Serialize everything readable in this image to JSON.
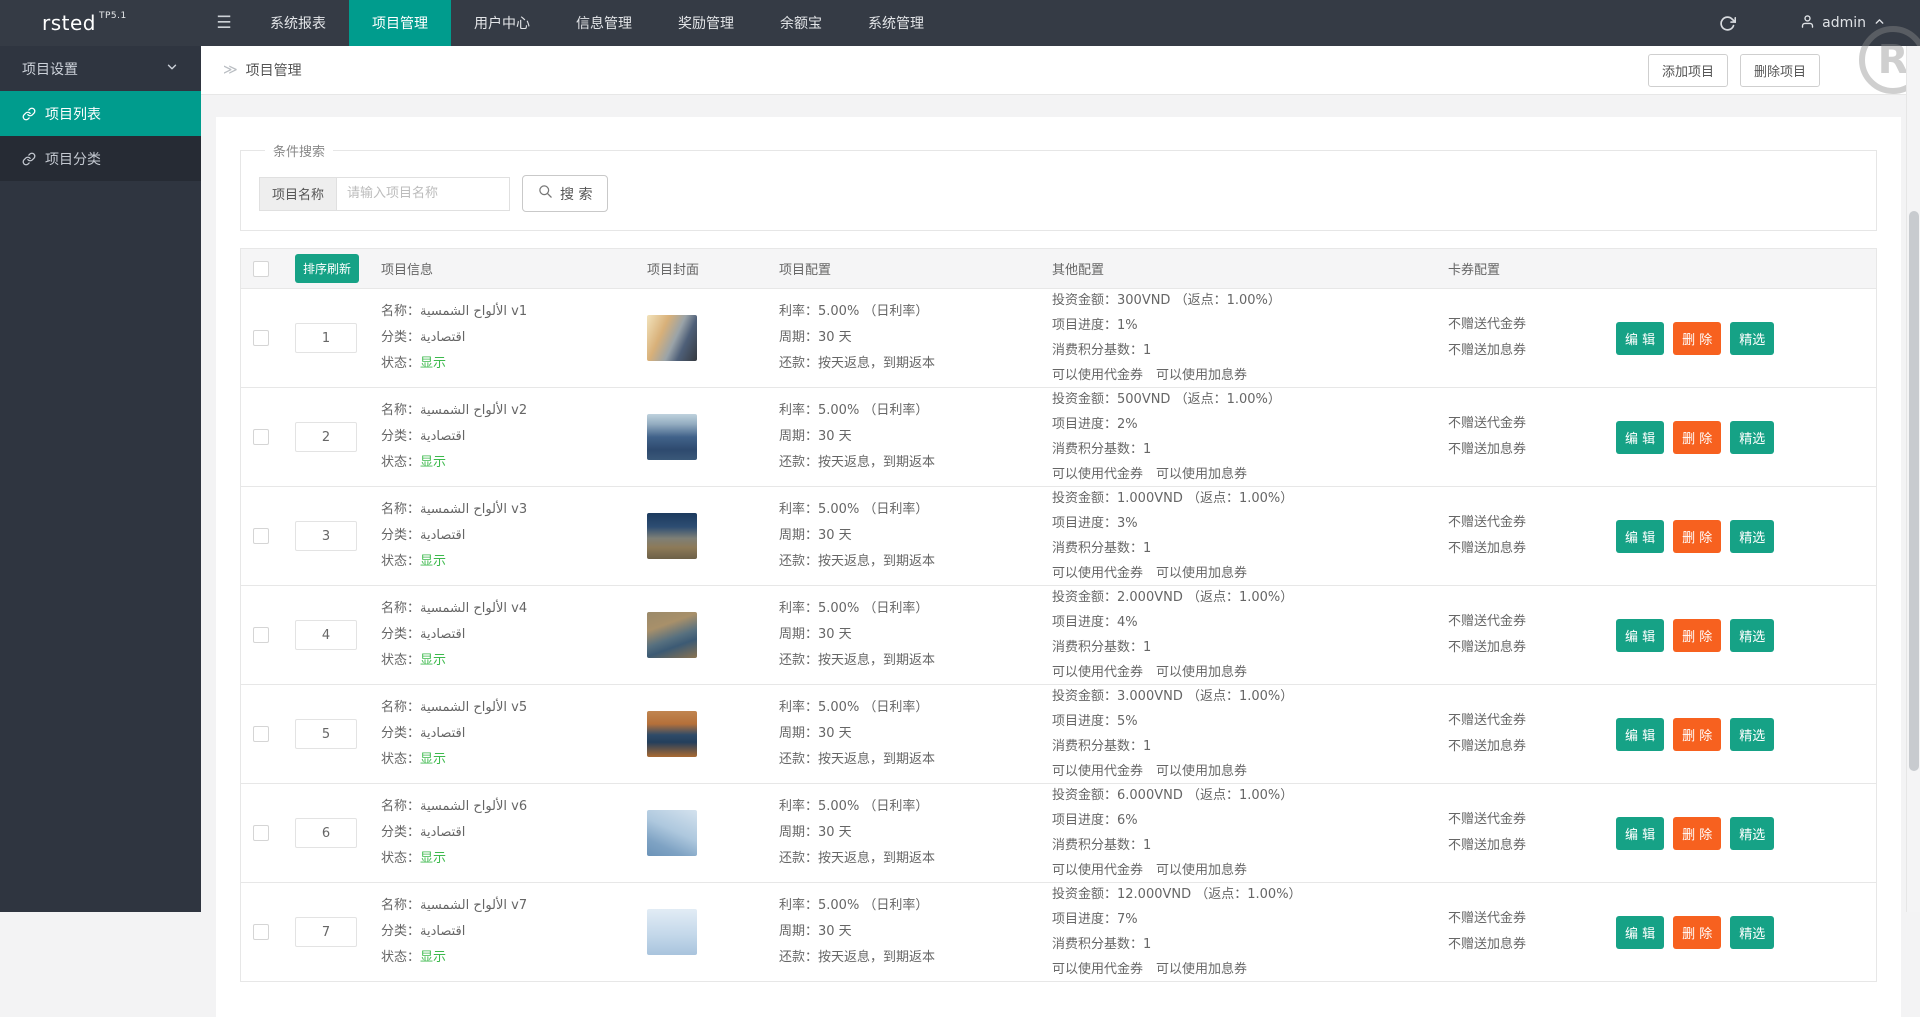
{
  "topbar": {
    "logo": "rsted",
    "logo_version": "TP5.1",
    "hamburger_icon": "☰",
    "menu": [
      {
        "label": "系统报表",
        "active": false
      },
      {
        "label": "项目管理",
        "active": true
      },
      {
        "label": "用户中心",
        "active": false
      },
      {
        "label": "信息管理",
        "active": false
      },
      {
        "label": "奖励管理",
        "active": false
      },
      {
        "label": "余额宝",
        "active": false
      },
      {
        "label": "系统管理",
        "active": false
      }
    ],
    "username": "admin"
  },
  "sidebar": {
    "group_label": "项目设置",
    "items": [
      {
        "label": "项目列表",
        "active": true
      },
      {
        "label": "项目分类",
        "active": false
      }
    ]
  },
  "breadcrumb": {
    "icon": "≫",
    "title": "项目管理"
  },
  "page_actions": {
    "add": "添加项目",
    "delete": "删除项目"
  },
  "watermark": "R",
  "search": {
    "legend": "条件搜索",
    "field_label": "项目名称",
    "placeholder": "请输入项目名称",
    "button_label": "搜 索"
  },
  "table": {
    "sort_button": "排序刷新",
    "headers": {
      "info": "项目信息",
      "cover": "项目封面",
      "config": "项目配置",
      "other": "其他配置",
      "coupon": "卡券配置"
    },
    "rows": [
      {
        "sort": "1",
        "name_label": "名称：",
        "name": "الألواح الشمسية v1",
        "cat_label": "分类：",
        "cat": "اقتصادية",
        "status_label": "状态：",
        "status": "显示",
        "cover": "linear-gradient(115deg,#f2e3bc 0%,#d8b079 32%,#9aa3a8 55%,#4e5f78 72%,#35393f 100%)",
        "config_lines": [
          "利率：5.00% （日利率）",
          "周期：30 天",
          "还款：按天返息，到期返本"
        ],
        "other_lines": [
          "投资金额：300VND （返点：1.00%）",
          "项目进度：1%",
          "消费积分基数：1",
          "可以使用代金券　可以使用加息券"
        ],
        "coupon_lines": [
          "不赠送代金券",
          "不赠送加息券"
        ],
        "actions": [
          {
            "label": "编 辑",
            "color": "teal"
          },
          {
            "label": "删 除",
            "color": "orange"
          },
          {
            "label": "精选",
            "color": "teal"
          }
        ]
      },
      {
        "sort": "2",
        "name_label": "名称：",
        "name": "الألواح الشمسية v2",
        "cat_label": "分类：",
        "cat": "اقتصادية",
        "status_label": "状态：",
        "status": "显示",
        "cover": "linear-gradient(180deg,#bfd2dd 0%,#93acc0 22%,#41628a 50%,#2e4a6e 78%,#3a5878 100%)",
        "config_lines": [
          "利率：5.00% （日利率）",
          "周期：30 天",
          "还款：按天返息，到期返本"
        ],
        "other_lines": [
          "投资金额：500VND （返点：1.00%）",
          "项目进度：2%",
          "消费积分基数：1",
          "可以使用代金券　可以使用加息券"
        ],
        "coupon_lines": [
          "不赠送代金券",
          "不赠送加息券"
        ],
        "actions": [
          {
            "label": "编 辑",
            "color": "teal"
          },
          {
            "label": "删 除",
            "color": "orange"
          },
          {
            "label": "精选",
            "color": "teal"
          }
        ]
      },
      {
        "sort": "3",
        "name_label": "名称：",
        "name": "الألواح الشمسية v3",
        "cat_label": "分类：",
        "cat": "اقتصادية",
        "status_label": "状态：",
        "status": "显示",
        "cover": "linear-gradient(180deg,#1c3a5e 0%,#2d4d72 30%,#7e7f76 55%,#8d7a58 75%,#6d6048 100%)",
        "config_lines": [
          "利率：5.00% （日利率）",
          "周期：30 天",
          "还款：按天返息，到期返本"
        ],
        "other_lines": [
          "投资金额：1.000VND （返点：1.00%）",
          "项目进度：3%",
          "消费积分基数：1",
          "可以使用代金券　可以使用加息券"
        ],
        "coupon_lines": [
          "不赠送代金券",
          "不赠送加息券"
        ],
        "actions": [
          {
            "label": "编 辑",
            "color": "teal"
          },
          {
            "label": "删 除",
            "color": "orange"
          },
          {
            "label": "精选",
            "color": "teal"
          }
        ]
      },
      {
        "sort": "4",
        "name_label": "名称：",
        "name": "الألواح الشمسية v4",
        "cat_label": "分类：",
        "cat": "اقتصادية",
        "status_label": "状态：",
        "status": "显示",
        "cover": "linear-gradient(160deg,#9b8a6a 0%,#a8906a 30%,#57707f 55%,#3c5a74 70%,#8a7351 100%)",
        "config_lines": [
          "利率：5.00% （日利率）",
          "周期：30 天",
          "还款：按天返息，到期返本"
        ],
        "other_lines": [
          "投资金额：2.000VND （返点：1.00%）",
          "项目进度：4%",
          "消费积分基数：1",
          "可以使用代金券　可以使用加息券"
        ],
        "coupon_lines": [
          "不赠送代金券",
          "不赠送加息券"
        ],
        "actions": [
          {
            "label": "编 辑",
            "color": "teal"
          },
          {
            "label": "删 除",
            "color": "orange"
          },
          {
            "label": "精选",
            "color": "teal"
          }
        ]
      },
      {
        "sort": "5",
        "name_label": "名称：",
        "name": "الألواح الشمسية v5",
        "cat_label": "分类：",
        "cat": "اقتصادية",
        "status_label": "状态：",
        "status": "显示",
        "cover": "linear-gradient(180deg,#c08550 0%,#b5703a 28%,#2f4b68 52%,#243f5c 68%,#a96a32 100%)",
        "config_lines": [
          "利率：5.00% （日利率）",
          "周期：30 天",
          "还款：按天返息，到期返本"
        ],
        "other_lines": [
          "投资金额：3.000VND （返点：1.00%）",
          "项目进度：5%",
          "消费积分基数：1",
          "可以使用代金券　可以使用加息券"
        ],
        "coupon_lines": [
          "不赠送代金券",
          "不赠送加息券"
        ],
        "actions": [
          {
            "label": "编 辑",
            "color": "teal"
          },
          {
            "label": "删 除",
            "color": "orange"
          },
          {
            "label": "精选",
            "color": "teal"
          }
        ]
      },
      {
        "sort": "6",
        "name_label": "名称：",
        "name": "الألواح الشمسية v6",
        "cat_label": "分类：",
        "cat": "اقتصادية",
        "status_label": "状态：",
        "status": "显示",
        "cover": "linear-gradient(205deg,#d4e2ee 0%,#aec8de 45%,#7fa3c4 75%,#6b93b8 100%)",
        "config_lines": [
          "利率：5.00% （日利率）",
          "周期：30 天",
          "还款：按天返息，到期返本"
        ],
        "other_lines": [
          "投资金额：6.000VND （返点：1.00%）",
          "项目进度：6%",
          "消费积分基数：1",
          "可以使用代金券　可以使用加息券"
        ],
        "coupon_lines": [
          "不赠送代金券",
          "不赠送加息券"
        ],
        "actions": [
          {
            "label": "编 辑",
            "color": "teal"
          },
          {
            "label": "删 除",
            "color": "orange"
          },
          {
            "label": "精选",
            "color": "teal"
          }
        ]
      },
      {
        "sort": "7",
        "name_label": "名称：",
        "name": "الألواح الشمسية v7",
        "cat_label": "分类：",
        "cat": "اقتصادية",
        "status_label": "状态：",
        "status": "显示",
        "cover": "linear-gradient(180deg,#e2ecf5 0%,#c4d8ea 55%,#a9c4dd 100%)",
        "config_lines": [
          "利率：5.00% （日利率）",
          "周期：30 天",
          "还款：按天返息，到期返本"
        ],
        "other_lines": [
          "投资金额：12.000VND （返点：1.00%）",
          "项目进度：7%",
          "消费积分基数：1",
          "可以使用代金券　可以使用加息券"
        ],
        "coupon_lines": [
          "不赠送代金券",
          "不赠送加息券"
        ],
        "actions": [
          {
            "label": "编 辑",
            "color": "teal"
          },
          {
            "label": "删 除",
            "color": "orange"
          },
          {
            "label": "精选",
            "color": "teal"
          }
        ]
      }
    ]
  },
  "colors": {
    "topbar_bg": "#353b45",
    "sidebar_bg": "#2f3540",
    "accent_teal": "#009c8d",
    "button_teal": "#16a286",
    "button_orange": "#f7611f",
    "status_green": "#3cb94c"
  }
}
